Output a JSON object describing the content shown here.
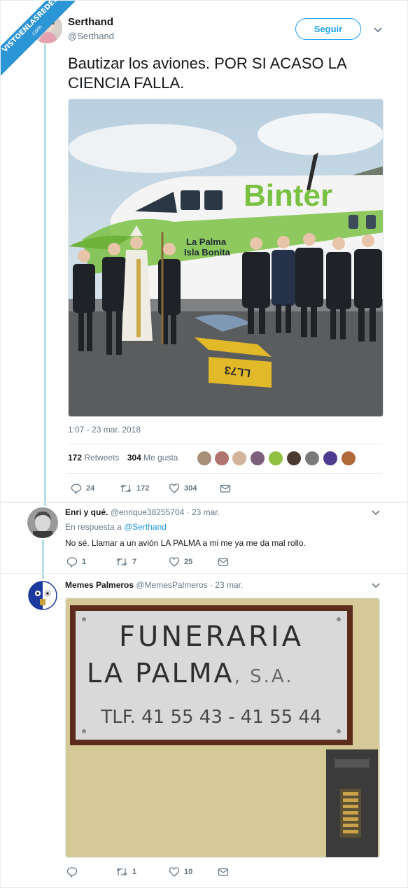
{
  "tweet": {
    "display_name": "Serthand",
    "handle": "@Serthand",
    "follow_label": "Seguir",
    "text": "Bautizar los aviones. POR SI ACASO LA CIENCIA FALLA.",
    "photo_text": {
      "brand": "Binter",
      "line1": "La Palma",
      "line2": "Isla Bonita",
      "ground_mark": "LL73"
    },
    "timestamp": "1:07 - 23 mar. 2018",
    "retweets_count": "172",
    "retweets_label": "Retweets",
    "likes_count": "304",
    "likes_label": "Me gusta",
    "actions": {
      "replies": "24",
      "retweets": "172",
      "likes": "304"
    }
  },
  "reply1": {
    "display_name": "Enri y qué.",
    "handle": "@enrique38255704",
    "date": "· 23 mar.",
    "in_reply_prefix": "En respuesta a",
    "in_reply_handle": "@Serthand",
    "text": "No sé. Llamar a un avión LA PALMA a mi me ya me da mal rollo.",
    "actions": {
      "replies": "1",
      "retweets": "7",
      "likes": "25"
    }
  },
  "reply2": {
    "display_name": "Memes Palmeros",
    "handle": "@MemesPalmeros",
    "date": "· 23 mar.",
    "sign": {
      "line1": "FUNERARIA",
      "line2": "LA PALMA",
      "suffix": ", S.A.",
      "line3": "TLF. 41 55 43  -  41 55 44"
    },
    "actions": {
      "replies": "",
      "retweets": "1",
      "likes": "10"
    }
  },
  "watermark": {
    "line1": "VISTOENLASREDES",
    "line2": ".com"
  },
  "colors": {
    "accent": "#1da1f2",
    "link": "#1b95e0",
    "muted": "#657786",
    "thread": "#b7dceb",
    "binter_green": "#7ac143"
  }
}
